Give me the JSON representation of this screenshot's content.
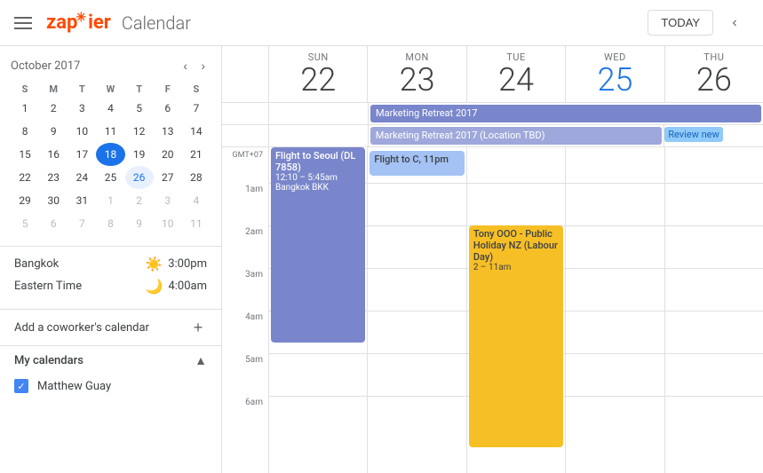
{
  "header": {
    "title": "Calendar",
    "today_label": "TODAY",
    "logo": "zapier"
  },
  "mini_calendar": {
    "month_year": "October 2017",
    "weekdays": [
      "S",
      "M",
      "T",
      "W",
      "T",
      "F",
      "S"
    ],
    "weeks": [
      [
        {
          "d": "1"
        },
        {
          "d": "2"
        },
        {
          "d": "3"
        },
        {
          "d": "4"
        },
        {
          "d": "5"
        },
        {
          "d": "6"
        },
        {
          "d": "7"
        }
      ],
      [
        {
          "d": "8"
        },
        {
          "d": "9"
        },
        {
          "d": "10"
        },
        {
          "d": "11"
        },
        {
          "d": "12"
        },
        {
          "d": "13"
        },
        {
          "d": "14"
        }
      ],
      [
        {
          "d": "15"
        },
        {
          "d": "16"
        },
        {
          "d": "17"
        },
        {
          "d": "18",
          "today": true
        },
        {
          "d": "19"
        },
        {
          "d": "20"
        },
        {
          "d": "21"
        }
      ],
      [
        {
          "d": "22"
        },
        {
          "d": "23"
        },
        {
          "d": "24"
        },
        {
          "d": "25"
        },
        {
          "d": "26",
          "selected": true
        },
        {
          "d": "27"
        },
        {
          "d": "28"
        }
      ],
      [
        {
          "d": "29"
        },
        {
          "d": "30"
        },
        {
          "d": "31"
        },
        {
          "d": "1",
          "faded": true
        },
        {
          "d": "2",
          "faded": true
        },
        {
          "d": "3",
          "faded": true
        },
        {
          "d": "4",
          "faded": true
        }
      ],
      [
        {
          "d": "5",
          "faded": true
        },
        {
          "d": "6",
          "faded": true
        },
        {
          "d": "7",
          "faded": true
        },
        {
          "d": "8",
          "faded": true
        },
        {
          "d": "9",
          "faded": true
        },
        {
          "d": "10",
          "faded": true
        },
        {
          "d": "11",
          "faded": true
        }
      ]
    ]
  },
  "timezones": [
    {
      "name": "Bangkok",
      "icon": "☀️",
      "time": "3:00pm"
    },
    {
      "name": "Eastern Time",
      "icon": "🌙",
      "time": "4:00am"
    }
  ],
  "add_coworker": {
    "label": "Add a coworker's calendar",
    "btn": "+"
  },
  "my_calendars": {
    "title": "My calendars",
    "items": [
      {
        "name": "Matthew Guay",
        "checked": true,
        "color": "#4285f4"
      }
    ]
  },
  "day_headers": [
    {
      "name": "Sun",
      "num": "22"
    },
    {
      "name": "Mon",
      "num": "23"
    },
    {
      "name": "Tue",
      "num": "24"
    },
    {
      "name": "Wed",
      "num": "25"
    },
    {
      "name": "Thu",
      "num": "26"
    }
  ],
  "allday_events": {
    "row1": {
      "span": "mon_thu",
      "label": "Marketing Retreat 2017",
      "color": "#7986cb"
    },
    "row2": {
      "span": "mon_thu",
      "label": "Marketing Retreat 2017 (Location TBD)",
      "color": "#9fa8da"
    },
    "review": "Review new"
  },
  "time_labels": [
    "GMT+07",
    "1am",
    "2am",
    "3am",
    "4am",
    "5am",
    "6am"
  ],
  "events": {
    "flight_seoul": {
      "title": "Flight to Seoul (DL 7858)",
      "detail": "12:10 – 5:45am",
      "location": "Bangkok BKK",
      "color": "purple"
    },
    "flight_c": {
      "title": "Flight to C, 11pm",
      "color": "blue_light"
    },
    "tony_ooo": {
      "title": "Tony OOO - Public Holiday NZ (Labour Day)",
      "time": "2 – 11am",
      "color": "yellow"
    }
  },
  "colors": {
    "today_blue": "#1a73e8",
    "purple": "#7986cb",
    "yellow": "#f6bf26",
    "blue_light": "#a4c2f4",
    "allday_blue": "#7986cb",
    "allday_blue2": "#9fa8da"
  }
}
